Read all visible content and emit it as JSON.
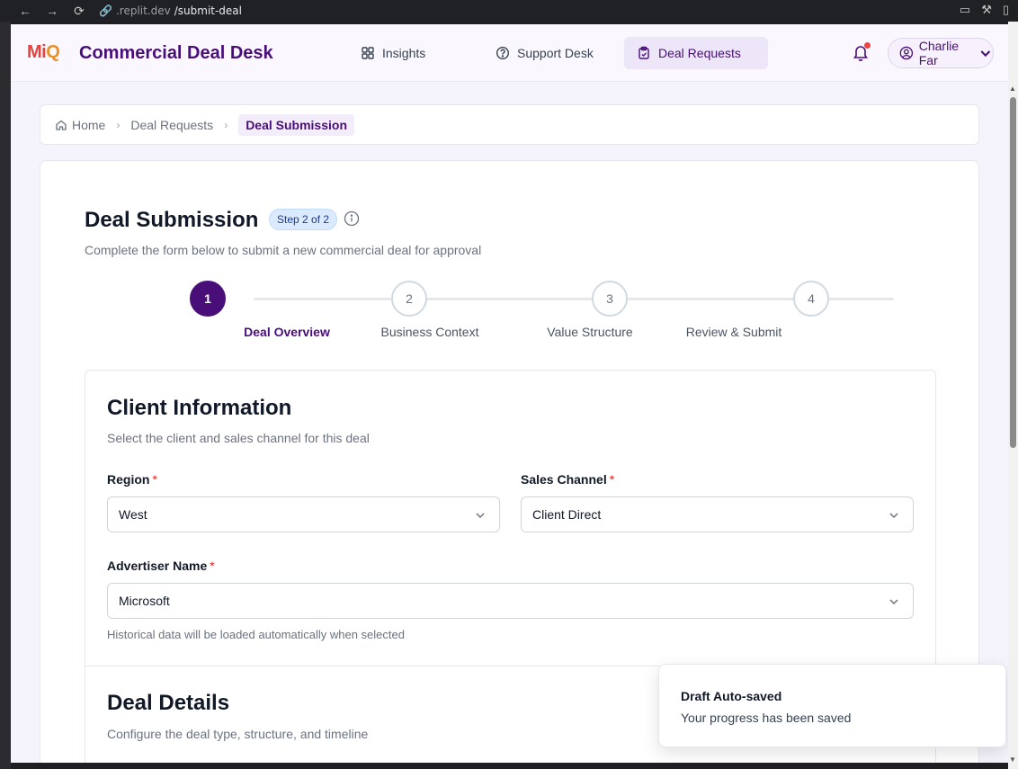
{
  "browser": {
    "url_host": ".replit.dev",
    "url_path": "/submit-deal"
  },
  "header": {
    "logo_mi": "Mi",
    "logo_q": "Q",
    "app_title": "Commercial Deal Desk",
    "nav": [
      {
        "label": "Insights",
        "icon": "grid-icon",
        "active": false
      },
      {
        "label": "Support Desk",
        "icon": "help-circle-icon",
        "active": false
      },
      {
        "label": "Deal Requests",
        "icon": "clipboard-icon",
        "active": true
      }
    ],
    "user_name": "Charlie Far",
    "notification_dot_color": "#ef4444"
  },
  "breadcrumb": {
    "home": "Home",
    "parent": "Deal Requests",
    "current": "Deal Submission"
  },
  "page": {
    "title": "Deal Submission",
    "step_badge": "Step 2 of 2",
    "subtitle": "Complete the form below to submit a new commercial deal for approval"
  },
  "stepper": {
    "steps": [
      {
        "number": "1",
        "label": "Deal Overview",
        "active": true
      },
      {
        "number": "2",
        "label": "Business Context",
        "active": false
      },
      {
        "number": "3",
        "label": "Value Structure",
        "active": false
      },
      {
        "number": "4",
        "label": "Review & Submit",
        "active": false
      }
    ]
  },
  "client_info": {
    "title": "Client Information",
    "subtitle": "Select the client and sales channel for this deal",
    "region_label": "Region",
    "region_value": "West",
    "channel_label": "Sales Channel",
    "channel_value": "Client Direct",
    "advertiser_label": "Advertiser Name",
    "advertiser_value": "Microsoft",
    "advertiser_help": "Historical data will be loaded automatically when selected",
    "required_mark": "*"
  },
  "deal_details": {
    "title": "Deal Details",
    "subtitle": "Configure the deal type, structure, and timeline"
  },
  "toast": {
    "title": "Draft Auto-saved",
    "message": "Your progress has been saved"
  },
  "colors": {
    "brand_purple": "#4a0e78",
    "required_red": "#dc2626"
  }
}
